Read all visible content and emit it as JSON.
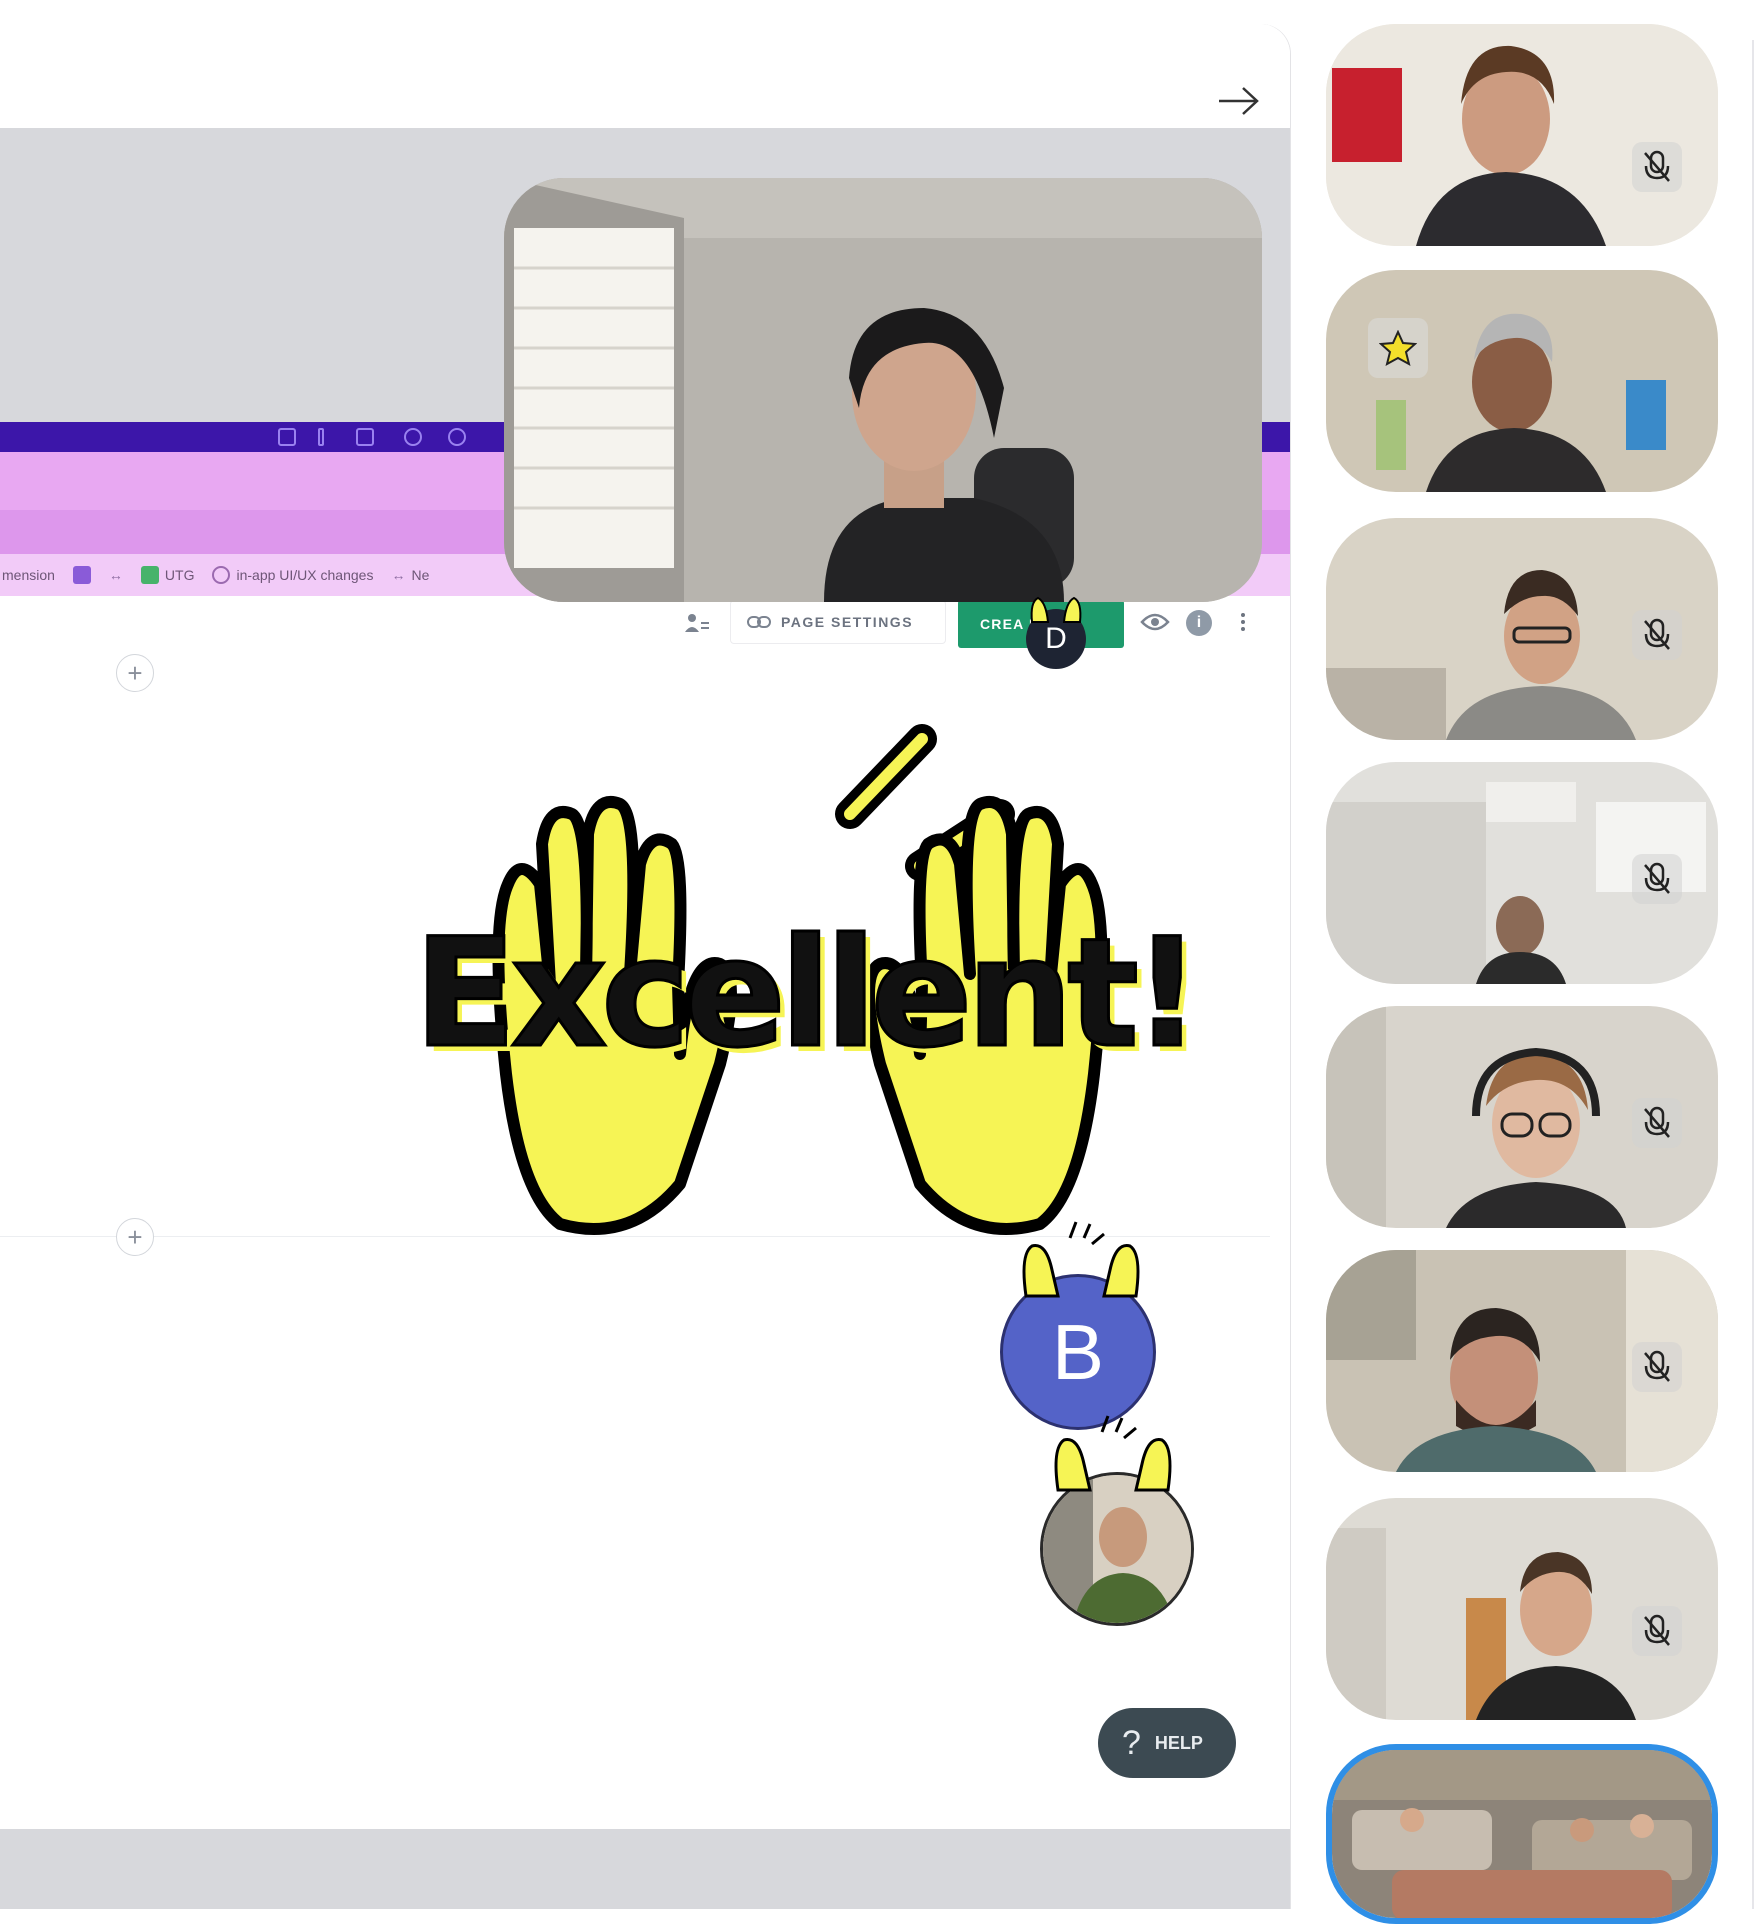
{
  "editor": {
    "bookmarks": [
      {
        "label": "mension",
        "color": "#d9a3e9"
      },
      {
        "label": "",
        "color": "#8a5bd8"
      },
      {
        "label": "",
        "color": "#c7a5e0"
      },
      {
        "label": "UTG",
        "color": "#47b36b"
      },
      {
        "label": "in-app UI/UX changes",
        "color": "#9b6ab0"
      },
      {
        "label": "Ne",
        "color": "#c9a3d8"
      }
    ],
    "page_settings_label": "PAGE SETTINGS",
    "create_label": "CREA   E",
    "info_glyph": "i"
  },
  "reaction": {
    "text": "Excellent!",
    "color": "#f6f455"
  },
  "avatars": {
    "b_letter": "B",
    "d_letter": "D",
    "b_color": "#5463c8"
  },
  "help": {
    "icon": "?",
    "label": "HELP"
  },
  "participants": [
    {
      "name": "participant-1",
      "muted": true,
      "starred": false,
      "active": false
    },
    {
      "name": "participant-2",
      "muted": false,
      "starred": true,
      "active": false
    },
    {
      "name": "participant-3",
      "muted": true,
      "starred": false,
      "active": false
    },
    {
      "name": "participant-4",
      "muted": true,
      "starred": false,
      "active": false
    },
    {
      "name": "participant-5",
      "muted": true,
      "starred": false,
      "active": false
    },
    {
      "name": "participant-6",
      "muted": true,
      "starred": false,
      "active": false
    },
    {
      "name": "participant-7",
      "muted": true,
      "starred": false,
      "active": false
    },
    {
      "name": "participant-8",
      "muted": false,
      "starred": false,
      "active": true
    }
  ],
  "colors": {
    "accent_green": "#1d9a6c",
    "purple_bar": "#3c16a9",
    "pink": "#e8a8f2",
    "active_ring": "#2f8fe6"
  }
}
